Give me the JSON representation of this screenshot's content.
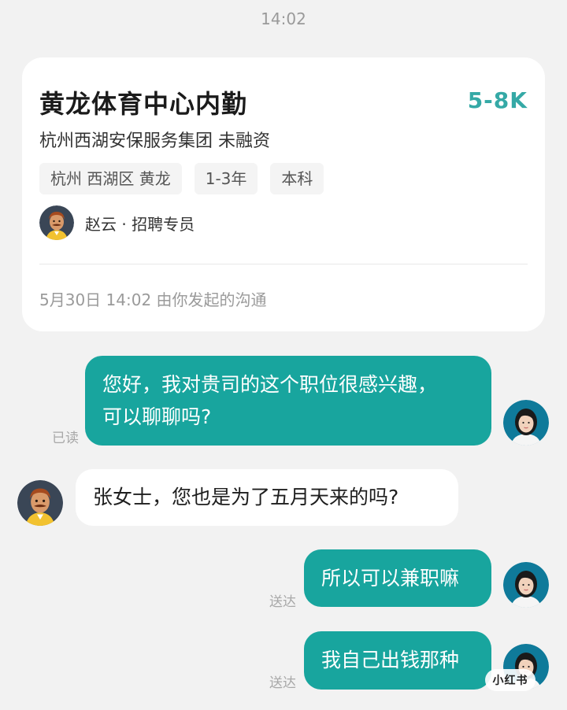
{
  "time": "14:02",
  "job": {
    "title": "黄龙体育中心内勤",
    "salary": "5-8K",
    "company": "杭州西湖安保服务集团 未融资",
    "tags": [
      "杭州 西湖区 黄龙",
      "1-3年",
      "本科"
    ],
    "recruiter": "赵云 · 招聘专员",
    "started_text": "5月30日 14:02 由你发起的沟通"
  },
  "messages": [
    {
      "text_line1": "您好，我对贵司的这个职位很感兴趣，",
      "text_line2": "可以聊聊吗?",
      "status": "已读"
    },
    {
      "text": "张女士，您也是为了五月天来的吗?"
    },
    {
      "text": "所以可以兼职嘛",
      "status": "送达"
    },
    {
      "text": "我自己出钱那种",
      "status": "送达"
    }
  ],
  "watermark": "小红书",
  "colors": {
    "accent": "#18a59e",
    "salary": "#35a9a6"
  }
}
